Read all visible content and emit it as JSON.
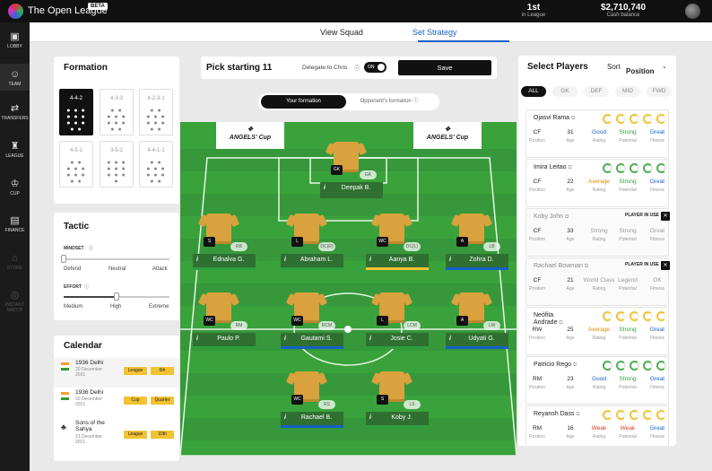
{
  "app": {
    "title": "The Open League",
    "beta": "BETA",
    "rank": "1st",
    "rank_label": "in League",
    "cash": "$2,710,740",
    "cash_label": "Cash balance"
  },
  "sidebar": [
    {
      "label": "LOBBY",
      "icon": "▣"
    },
    {
      "label": "TEAM",
      "icon": "☺"
    },
    {
      "label": "TRANSFERS",
      "icon": "⇄"
    },
    {
      "label": "LEAGUE",
      "icon": "♜"
    },
    {
      "label": "CUP",
      "icon": "♔"
    },
    {
      "label": "FINANCE",
      "icon": "▤"
    },
    {
      "label": "STORE",
      "icon": "⌂"
    },
    {
      "label": "INSTANT MATCH",
      "icon": "◎"
    }
  ],
  "tabs": {
    "squad": "View Squad",
    "strategy": "Set Strategy"
  },
  "formation": {
    "title": "Formation",
    "options": [
      "4-4-2",
      "4-3-3",
      "4-2-3-1",
      "4-5-1",
      "3-5-2",
      "4-4-1-1"
    ]
  },
  "tactic": {
    "title": "Tactic",
    "mindset": "MINDSET",
    "defend": "Defend",
    "neutral": "Neutral",
    "attack": "Attack",
    "mindset_value": 0,
    "effort": "EFFORT",
    "medium": "Medium",
    "high": "High",
    "extreme": "Extreme",
    "effort_value": 0.5
  },
  "calendar": {
    "title": "Calendar",
    "items": [
      {
        "team": "1936 Delhi",
        "date": "20 December",
        "year": "2021",
        "type": "League",
        "stage": "6th"
      },
      {
        "team": "1936 Delhi",
        "date": "20 December",
        "year": "2021",
        "type": "Cup",
        "stage": "Quarter"
      },
      {
        "team": "Sons of the Sahya",
        "date": "21 December",
        "year": "2021",
        "type": "League",
        "stage": "10th"
      }
    ]
  },
  "pitch_header": {
    "title": "Pick starting 11",
    "delegate": "Delegate to Chris",
    "toggle": "ON",
    "save": "Save",
    "your": "Your formation",
    "opp": "Opponent's formation",
    "sponsor": "ANGELS' Cup"
  },
  "players": [
    {
      "name": "Deepak B.",
      "pos": "GK",
      "role": "GK",
      "bar": "#2f6f31"
    },
    {
      "name": "Ednalva G.",
      "pos": "S",
      "role": "RB",
      "bar": "#2e9e3e"
    },
    {
      "name": "Abraham L.",
      "pos": "L",
      "role": "DC(R)",
      "bar": "#2e9e3e"
    },
    {
      "name": "Aanya B.",
      "pos": "WC",
      "role": "DC(L)",
      "bar": "#f1c232"
    },
    {
      "name": "Zohra D.",
      "pos": "A",
      "role": "LB",
      "bar": "#1560c8"
    },
    {
      "name": "Paulo P.",
      "pos": "WC",
      "role": "RM",
      "bar": "#2e9e3e"
    },
    {
      "name": "Gautami S.",
      "pos": "WC",
      "role": "RCM",
      "bar": "#1560c8"
    },
    {
      "name": "Josie C.",
      "pos": "L",
      "role": "LCM",
      "bar": "#2e9e3e"
    },
    {
      "name": "Udyati G.",
      "pos": "A",
      "role": "LM",
      "bar": "#1560c8"
    },
    {
      "name": "Rachael B.",
      "pos": "WC",
      "role": "RS",
      "bar": "#1560c8"
    },
    {
      "name": "Koby J.",
      "pos": "S",
      "role": "LS",
      "bar": "#2e9e3e"
    }
  ],
  "select": {
    "title": "Select Players",
    "sort": "Sort",
    "sort_value": "Position",
    "filters": [
      "ALL",
      "GK",
      "DEF",
      "MID",
      "FWD"
    ],
    "in_use": "PLAYER IN USE",
    "labels": {
      "position": "Position",
      "age": "Age",
      "rating": "Rating",
      "potential": "Potential",
      "fitness": "Fitness"
    },
    "cards": [
      {
        "name": "Ojasvi Rama",
        "pos": "CF",
        "age": "31",
        "rating": "Good",
        "potential": "Strong",
        "fitness": "Great",
        "inuse": false
      },
      {
        "name": "Imira Leitao",
        "pos": "CF",
        "age": "22",
        "rating": "Average",
        "potential": "Strong",
        "fitness": "Great",
        "inuse": false
      },
      {
        "name": "Koby John",
        "pos": "CF",
        "age": "33",
        "rating": "Strong",
        "potential": "Strong",
        "fitness": "Great",
        "inuse": true
      },
      {
        "name": "Rachael Bowman",
        "pos": "CF",
        "age": "21",
        "rating": "World Class",
        "potential": "Legend",
        "fitness": "OK",
        "inuse": true
      },
      {
        "name": "Neófita Andrade",
        "pos": "RW",
        "age": "25",
        "rating": "Average",
        "potential": "Strong",
        "fitness": "Great",
        "inuse": false
      },
      {
        "name": "Patricio Rego",
        "pos": "RM",
        "age": "23",
        "rating": "Good",
        "potential": "Strong",
        "fitness": "Great",
        "inuse": false
      },
      {
        "name": "Reyansh Dass",
        "pos": "RM",
        "age": "16",
        "rating": "Weak",
        "potential": "Weak",
        "fitness": "Great",
        "inuse": false
      }
    ]
  }
}
